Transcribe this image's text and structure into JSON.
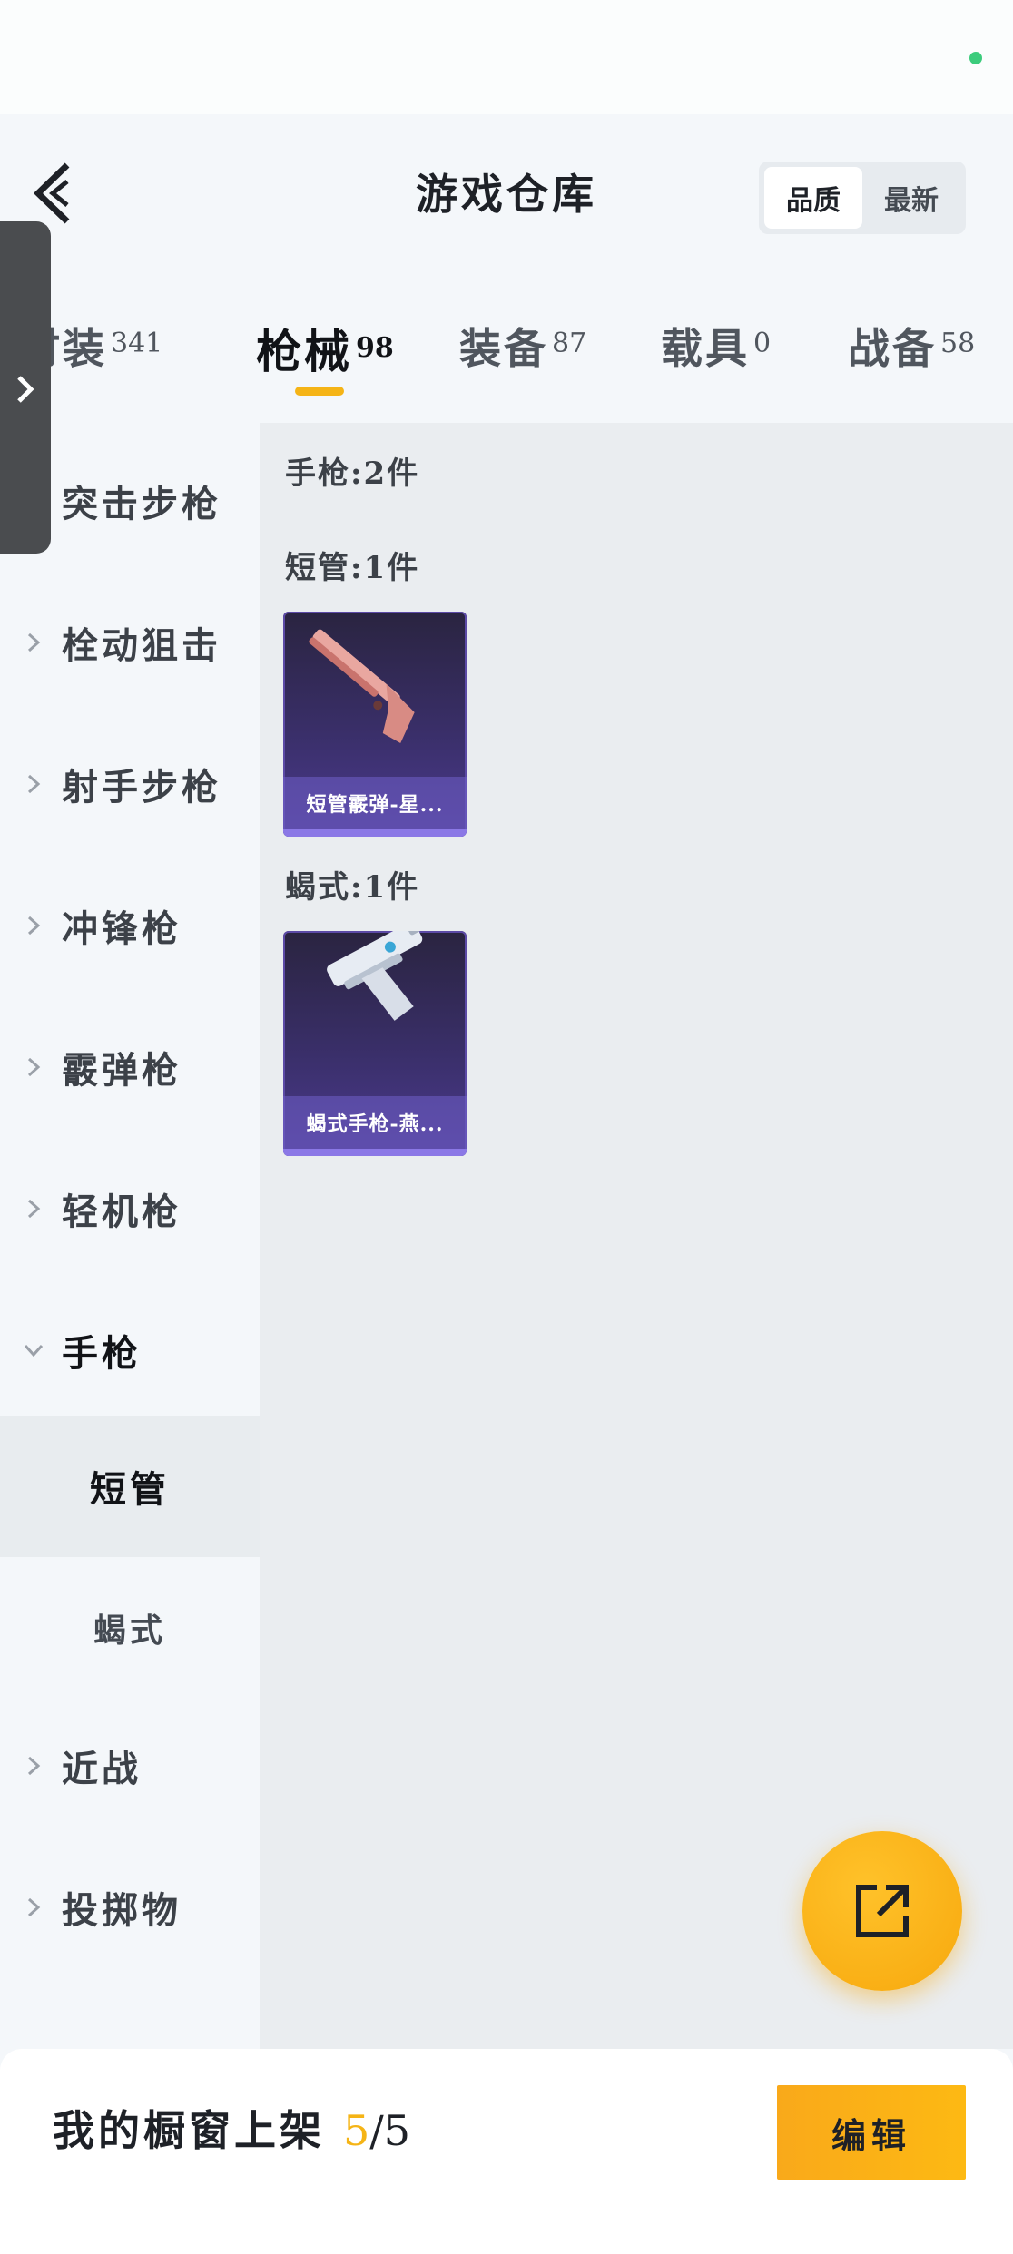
{
  "header": {
    "title": "游戏仓库",
    "sort_options": [
      "品质",
      "最新"
    ],
    "sort_active": "品质"
  },
  "category_tabs": [
    {
      "label": "时装",
      "count": "341",
      "active": false
    },
    {
      "label": "枪械",
      "count": "98",
      "active": true
    },
    {
      "label": "装备",
      "count": "87",
      "active": false
    },
    {
      "label": "载具",
      "count": "0",
      "active": false
    },
    {
      "label": "战备",
      "count": "58",
      "active": false
    }
  ],
  "sidebar": {
    "items": [
      {
        "label": "突击步枪"
      },
      {
        "label": "栓动狙击"
      },
      {
        "label": "射手步枪"
      },
      {
        "label": "冲锋枪"
      },
      {
        "label": "霰弹枪"
      },
      {
        "label": "轻机枪"
      },
      {
        "label": "手枪",
        "expanded": true
      }
    ],
    "subitems": [
      {
        "label": "短管",
        "active": true
      },
      {
        "label": "蝎式",
        "active": false
      }
    ],
    "items_after": [
      {
        "label": "近战"
      },
      {
        "label": "投掷物"
      }
    ]
  },
  "content": {
    "summary": "手枪:2件",
    "groups": [
      {
        "title": "短管:1件",
        "items": [
          {
            "name": "短管霰弹-星..."
          }
        ]
      },
      {
        "title": "蝎式:1件",
        "items": [
          {
            "name": "蝎式手枪-燕..."
          }
        ]
      }
    ]
  },
  "footer": {
    "prefix": "我的橱窗上架",
    "current": "5",
    "separator_total": "/5",
    "edit_label": "编辑"
  },
  "colors": {
    "accent": "#f5b416",
    "card_purple": "#4b3a8e",
    "status_dot": "#3ccc7c"
  },
  "icons": [
    "back-arrow-icon",
    "chevron-right-icon",
    "chevron-down-icon",
    "share-external-icon"
  ]
}
